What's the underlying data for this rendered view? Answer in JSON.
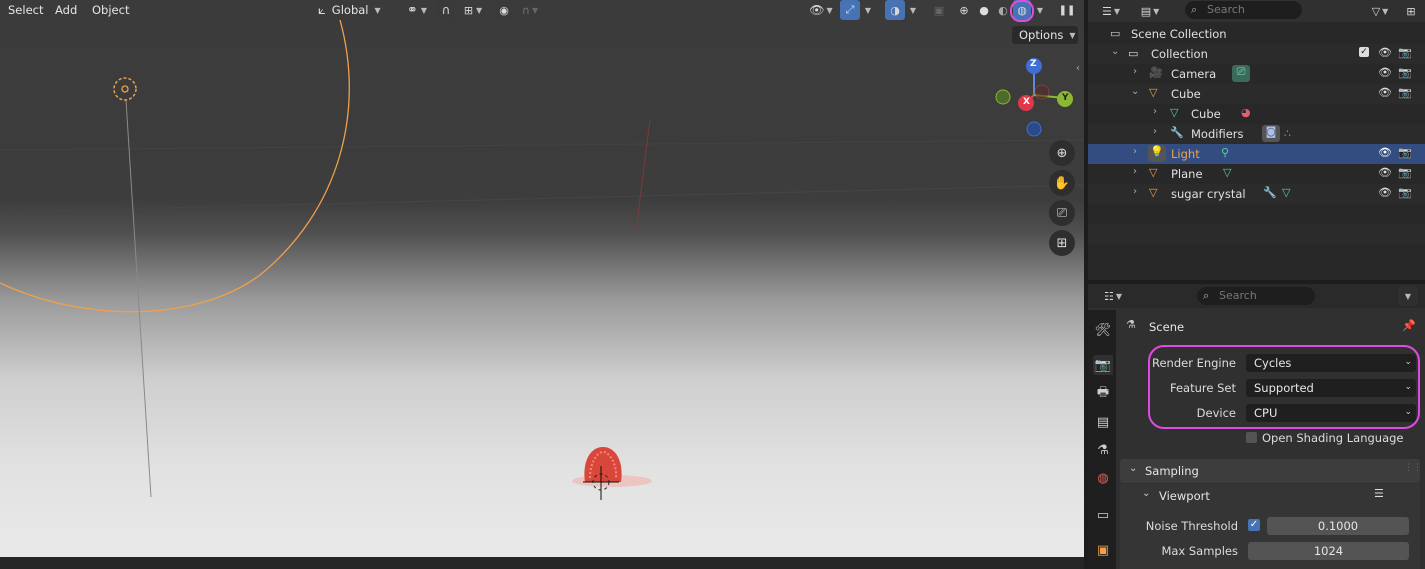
{
  "viewport": {
    "menu": [
      "Select",
      "Add",
      "Object"
    ],
    "transform_orientation": "Global",
    "options_label": "Options",
    "gizmo": {
      "z": "Z",
      "x": "X",
      "y": "Y"
    }
  },
  "outliner": {
    "search_placeholder": "Search",
    "scene_collection": "Scene Collection",
    "rows": [
      {
        "label": "Collection"
      },
      {
        "label": "Camera"
      },
      {
        "label": "Cube"
      },
      {
        "label": "Cube"
      },
      {
        "label": "Modifiers"
      },
      {
        "label": "Light",
        "selected": true
      },
      {
        "label": "Plane"
      },
      {
        "label": "sugar crystal"
      }
    ]
  },
  "properties": {
    "search_placeholder": "Search",
    "context": "Scene",
    "render_engine": {
      "label": "Render Engine",
      "value": "Cycles"
    },
    "feature_set": {
      "label": "Feature Set",
      "value": "Supported"
    },
    "device": {
      "label": "Device",
      "value": "CPU"
    },
    "osl": {
      "label": "Open Shading Language",
      "checked": false
    },
    "sampling": {
      "title": "Sampling",
      "viewport_title": "Viewport",
      "noise_threshold": {
        "label": "Noise Threshold",
        "value": "0.1000",
        "enabled": true
      },
      "max_samples": {
        "label": "Max Samples",
        "value": "1024"
      }
    }
  },
  "colors": {
    "accent": "#4772b3",
    "highlight": "#e04ae0",
    "light_orange": "#f0a04a",
    "selected_row": "#334d80"
  }
}
